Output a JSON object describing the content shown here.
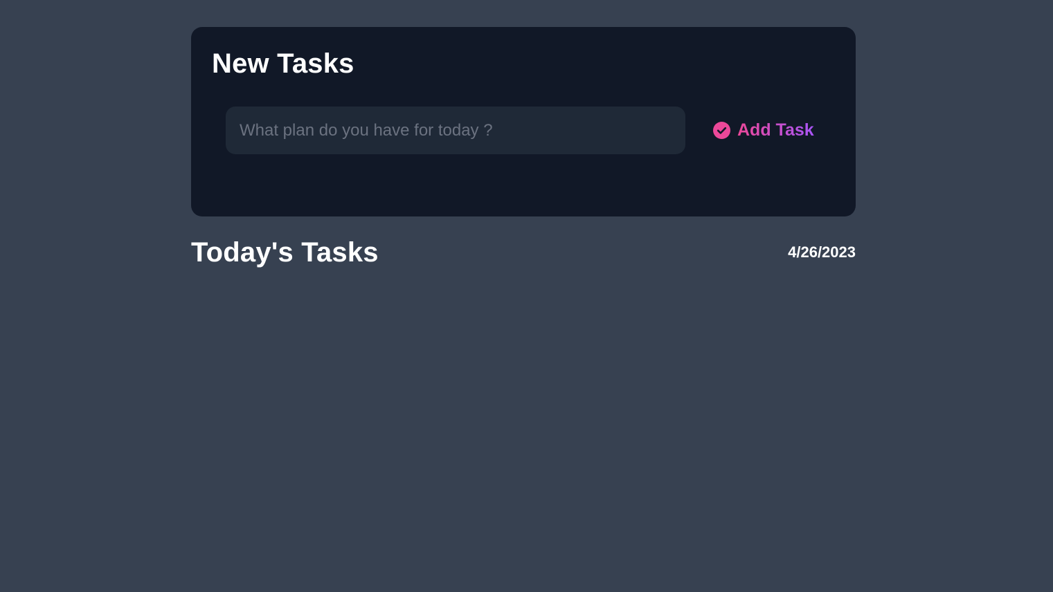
{
  "new_task": {
    "title": "New Tasks",
    "input_placeholder": "What plan do you have for today ?",
    "input_value": "",
    "add_button_label": "Add Task",
    "add_button_icon": "check-circle-icon"
  },
  "today": {
    "title": "Today's Tasks",
    "date": "4/26/2023",
    "tasks": []
  },
  "colors": {
    "page_background": "#374151",
    "card_background": "#111827",
    "input_background": "#1f2937",
    "accent_pink": "#ec4899",
    "accent_purple": "#a855f7"
  }
}
